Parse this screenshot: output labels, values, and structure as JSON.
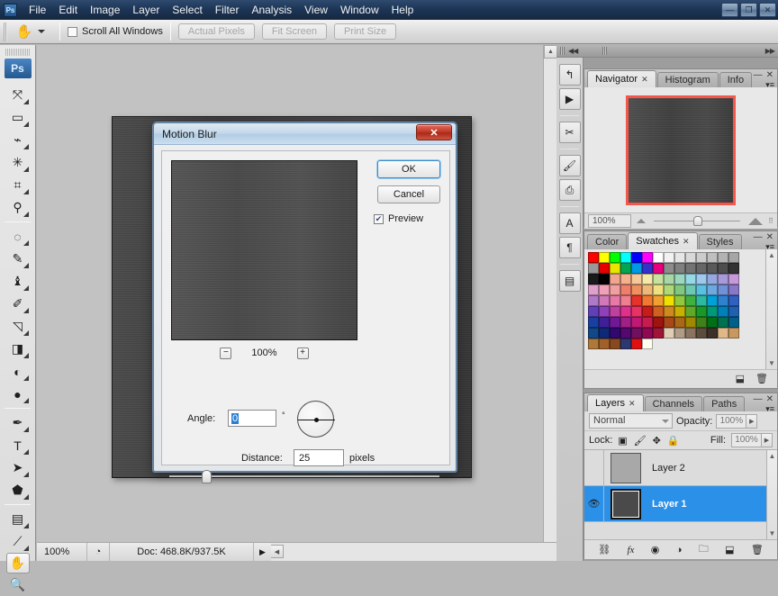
{
  "app": {
    "logo": "Ps",
    "menus": [
      "File",
      "Edit",
      "Image",
      "Layer",
      "Select",
      "Filter",
      "Analysis",
      "View",
      "Window",
      "Help"
    ],
    "window_controls": [
      {
        "name": "minimize",
        "glyph": "—"
      },
      {
        "name": "restore",
        "glyph": "❐"
      },
      {
        "name": "close",
        "glyph": "✕"
      }
    ]
  },
  "options_bar": {
    "tool_icon": "hand-tool",
    "scroll_all_windows_label": "Scroll All Windows",
    "scroll_all_windows_checked": false,
    "buttons": [
      "Actual Pixels",
      "Fit Screen",
      "Print Size"
    ]
  },
  "toolbar": {
    "logo": "Ps",
    "groups": [
      [
        {
          "name": "move-tool",
          "glyph": "⤧",
          "has_flyout": true,
          "selected": false
        },
        {
          "name": "marquee-tool",
          "glyph": "▭",
          "has_flyout": true,
          "selected": false
        },
        {
          "name": "lasso-tool",
          "glyph": "⌁",
          "has_flyout": true,
          "selected": false
        },
        {
          "name": "magic-wand-tool",
          "glyph": "✳",
          "has_flyout": true,
          "selected": false
        },
        {
          "name": "crop-tool",
          "glyph": "⌗",
          "has_flyout": true,
          "selected": false
        },
        {
          "name": "eyedropper-tool",
          "glyph": "⚲",
          "has_flyout": true,
          "selected": false
        }
      ],
      [
        {
          "name": "healing-brush-tool",
          "glyph": "◌",
          "has_flyout": true,
          "selected": false
        },
        {
          "name": "brush-tool",
          "glyph": "✎",
          "has_flyout": true,
          "selected": false
        },
        {
          "name": "clone-stamp-tool",
          "glyph": "♝",
          "has_flyout": true,
          "selected": false
        },
        {
          "name": "history-brush-tool",
          "glyph": "✐",
          "has_flyout": true,
          "selected": false
        },
        {
          "name": "eraser-tool",
          "glyph": "◹",
          "has_flyout": true,
          "selected": false
        },
        {
          "name": "gradient-tool",
          "glyph": "◨",
          "has_flyout": true,
          "selected": false
        },
        {
          "name": "blur-tool",
          "glyph": "◐",
          "has_flyout": true,
          "selected": false
        },
        {
          "name": "dodge-tool",
          "glyph": "●",
          "has_flyout": true,
          "selected": false
        }
      ],
      [
        {
          "name": "pen-tool",
          "glyph": "✒",
          "has_flyout": true,
          "selected": false
        },
        {
          "name": "type-tool",
          "glyph": "T",
          "has_flyout": true,
          "selected": false
        },
        {
          "name": "path-selection-tool",
          "glyph": "➤",
          "has_flyout": true,
          "selected": false
        },
        {
          "name": "shape-tool",
          "glyph": "⬟",
          "has_flyout": true,
          "selected": false
        }
      ],
      [
        {
          "name": "notes-tool",
          "glyph": "▤",
          "has_flyout": true,
          "selected": false
        },
        {
          "name": "color-sampler-tool",
          "glyph": "⟋",
          "has_flyout": true,
          "selected": false
        },
        {
          "name": "hand-tool",
          "glyph": "✋",
          "has_flyout": false,
          "selected": true
        },
        {
          "name": "zoom-tool",
          "glyph": "🔍",
          "has_flyout": false,
          "selected": false
        }
      ]
    ]
  },
  "status_bar": {
    "zoom": "100%",
    "icon": "doc-icon",
    "doc_info": "Doc: 468.8K/937.5K",
    "arrow": "▶"
  },
  "dock": {
    "collapse_glyph": "◀◀",
    "expand_glyph": "▶▶",
    "icon_rail": [
      {
        "name": "history-icon",
        "glyph": "↰"
      },
      {
        "name": "actions-icon",
        "glyph": "▶"
      },
      {
        "name": "tool-presets-icon",
        "glyph": "✂"
      },
      {
        "name": "brushes-icon",
        "glyph": "🖌"
      },
      {
        "name": "clone-source-icon",
        "glyph": "⎙"
      },
      {
        "name": "character-icon",
        "glyph": "A"
      },
      {
        "name": "paragraph-icon",
        "glyph": "¶"
      },
      {
        "name": "layer-comps-icon",
        "glyph": "▤"
      }
    ]
  },
  "navigator_panel": {
    "tabs": [
      {
        "label": "Navigator",
        "active": true,
        "closable": true
      },
      {
        "label": "Histogram",
        "active": false,
        "closable": false
      },
      {
        "label": "Info",
        "active": false,
        "closable": false
      }
    ],
    "zoom_value": "100%",
    "thumbnail_border_color": "#f4564a",
    "minimize_glyph": "—",
    "close_glyph": "✕",
    "menu_glyph": "▾≡"
  },
  "swatches_panel": {
    "tabs": [
      {
        "label": "Color",
        "active": false,
        "closable": false
      },
      {
        "label": "Swatches",
        "active": true,
        "closable": true
      },
      {
        "label": "Styles",
        "active": false,
        "closable": false
      }
    ],
    "footer_icons": [
      {
        "name": "new-swatch-icon",
        "glyph": "⬓"
      },
      {
        "name": "delete-swatch-icon",
        "glyph": "🗑"
      }
    ],
    "colors": [
      "#ff0000",
      "#ffff00",
      "#00ff00",
      "#00ffff",
      "#0000ff",
      "#ff00ff",
      "#ffffff",
      "#f2f2f2",
      "#e6e6e6",
      "#d9d9d9",
      "#cccccc",
      "#bfbfbf",
      "#b3b3b3",
      "#a6a6a6",
      "#999999",
      "#e60000",
      "#e6e600",
      "#00a651",
      "#0099e6",
      "#3333cc",
      "#e6007e",
      "#8c8c8c",
      "#808080",
      "#737373",
      "#666666",
      "#595959",
      "#4d4d4d",
      "#333333",
      "#1a1a1a",
      "#000000",
      "#f0a58c",
      "#f5b08c",
      "#f5c99c",
      "#f5e8a8",
      "#c8e0a0",
      "#a8d6a8",
      "#9ad8c0",
      "#96d8e6",
      "#9ec8ee",
      "#96a8e0",
      "#a89ad8",
      "#c69ad8",
      "#e0a0cc",
      "#f0a0b8",
      "#f0a0a0",
      "#ef7f6a",
      "#f09060",
      "#f0b878",
      "#f0e080",
      "#b0d878",
      "#80c880",
      "#6cc8b0",
      "#58c0e0",
      "#6ea8e0",
      "#7090d8",
      "#8878c8",
      "#b078c8",
      "#d078b8",
      "#e878a8",
      "#ef7f90",
      "#e63228",
      "#f07830",
      "#efa030",
      "#f0e000",
      "#90c840",
      "#40b040",
      "#2db8a0",
      "#00a0d8",
      "#3080d0",
      "#3060c0",
      "#6040b8",
      "#9040b8",
      "#c040a0",
      "#e0308c",
      "#e63264",
      "#c81c18",
      "#d06020",
      "#d08820",
      "#c8b000",
      "#60a828",
      "#189828",
      "#009878",
      "#0080b8",
      "#2060b0",
      "#1840a0",
      "#402098",
      "#701898",
      "#a02088",
      "#c01874",
      "#c81c50",
      "#a01410",
      "#a84818",
      "#a86818",
      "#a08800",
      "#408018",
      "#007018",
      "#00704f",
      "#006088",
      "#104888",
      "#102878",
      "#300870",
      "#540870",
      "#701060",
      "#900854",
      "#a01438",
      "#e0cdb4",
      "#b09c84",
      "#8a7460",
      "#5c4c3c",
      "#3c3028",
      "#e0b888",
      "#c89860",
      "#b07838",
      "#a06028",
      "#884820",
      "#2c3870",
      "#e01010",
      "#fffff0",
      "",
      "",
      "",
      "",
      "",
      "",
      "",
      "",
      "",
      "",
      "",
      "",
      "",
      "",
      "",
      "",
      ""
    ]
  },
  "layers_panel": {
    "tabs": [
      {
        "label": "Layers",
        "active": true,
        "closable": true
      },
      {
        "label": "Channels",
        "active": false,
        "closable": false
      },
      {
        "label": "Paths",
        "active": false,
        "closable": false
      }
    ],
    "blend_mode": "Normal",
    "opacity_label": "Opacity:",
    "opacity_value": "100%",
    "lock_label": "Lock:",
    "lock_icons": [
      {
        "name": "lock-transparent-pixels-icon",
        "glyph": "▣"
      },
      {
        "name": "lock-image-pixels-icon",
        "glyph": "🖌"
      },
      {
        "name": "lock-position-icon",
        "glyph": "✥"
      },
      {
        "name": "lock-all-icon",
        "glyph": "🔒"
      }
    ],
    "fill_label": "Fill:",
    "fill_value": "100%",
    "layers": [
      {
        "name": "Layer 2",
        "visible": false,
        "selected": false,
        "thumb_color": "#a8a8a8"
      },
      {
        "name": "Layer 1",
        "visible": true,
        "selected": true,
        "thumb_color": "#4a4a4a"
      }
    ],
    "footer_icons": [
      {
        "name": "link-layers-icon",
        "glyph": "⛓"
      },
      {
        "name": "layer-style-icon",
        "glyph": "fx"
      },
      {
        "name": "layer-mask-icon",
        "glyph": "◉"
      },
      {
        "name": "adjustment-layer-icon",
        "glyph": "◑"
      },
      {
        "name": "new-group-icon",
        "glyph": "🗀"
      },
      {
        "name": "new-layer-icon",
        "glyph": "⬓"
      },
      {
        "name": "delete-layer-icon",
        "glyph": "🗑"
      }
    ]
  },
  "dialog": {
    "title": "Motion Blur",
    "close_glyph": "✕",
    "ok_label": "OK",
    "cancel_label": "Cancel",
    "preview_label": "Preview",
    "preview_checked": true,
    "preview_check_glyph": "✔",
    "zoom_out_glyph": "−",
    "zoom_level": "100%",
    "zoom_in_glyph": "+",
    "angle_label": "Angle:",
    "angle_value": "0",
    "degree_symbol": "°",
    "distance_label": "Distance:",
    "distance_value": "25",
    "distance_unit": "pixels"
  }
}
